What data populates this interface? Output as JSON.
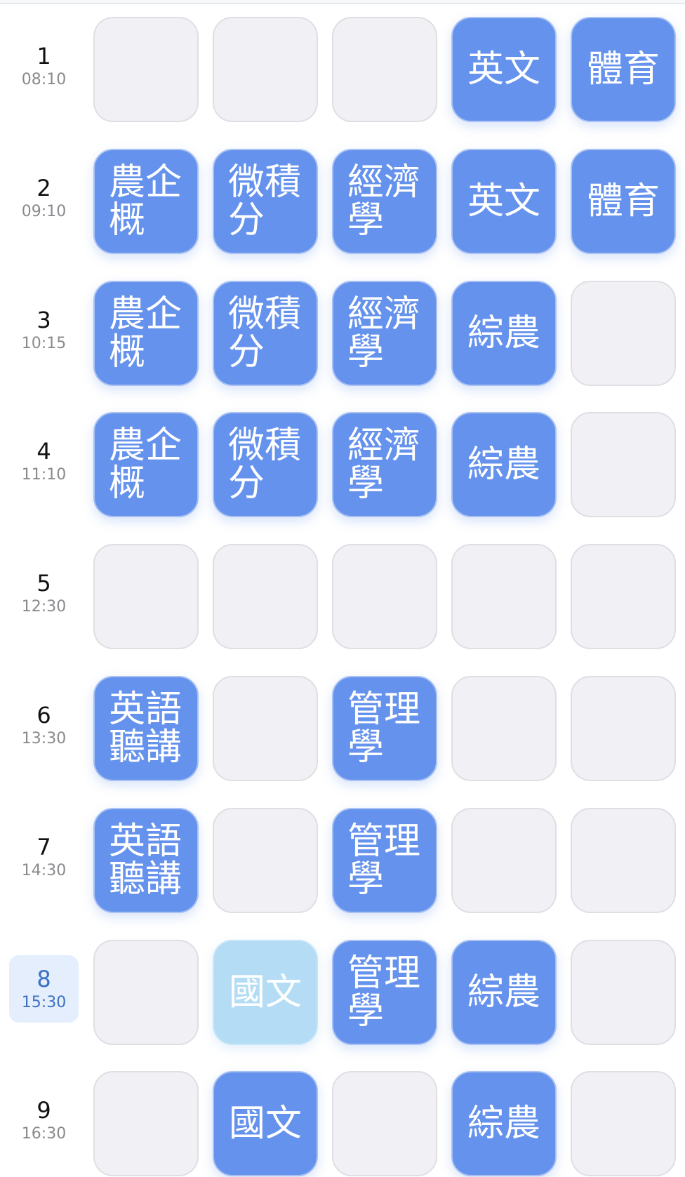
{
  "colors": {
    "course": "#6592ec",
    "course_current": "#b4ddf5",
    "empty": "#f1f1f5",
    "current_period_bg": "#e4eefc",
    "current_period_text": "#3b70c4"
  },
  "periods": [
    {
      "num": "1",
      "time": "08:10",
      "current": false,
      "cells": [
        "",
        "",
        "",
        "英文",
        "體育"
      ]
    },
    {
      "num": "2",
      "time": "09:10",
      "current": false,
      "cells": [
        "農企概",
        "微積分",
        "經濟學",
        "英文",
        "體育"
      ]
    },
    {
      "num": "3",
      "time": "10:15",
      "current": false,
      "cells": [
        "農企概",
        "微積分",
        "經濟學",
        "綜農",
        ""
      ]
    },
    {
      "num": "4",
      "time": "11:10",
      "current": false,
      "cells": [
        "農企概",
        "微積分",
        "經濟學",
        "綜農",
        ""
      ]
    },
    {
      "num": "5",
      "time": "12:30",
      "current": false,
      "cells": [
        "",
        "",
        "",
        "",
        ""
      ]
    },
    {
      "num": "6",
      "time": "13:30",
      "current": false,
      "cells": [
        "英語聽講",
        "",
        "管理學",
        "",
        ""
      ]
    },
    {
      "num": "7",
      "time": "14:30",
      "current": false,
      "cells": [
        "英語聽講",
        "",
        "管理學",
        "",
        ""
      ]
    },
    {
      "num": "8",
      "time": "15:30",
      "current": true,
      "cells": [
        "",
        "國文",
        "管理學",
        "綜農",
        ""
      ],
      "current_cell": 1
    },
    {
      "num": "9",
      "time": "16:30",
      "current": false,
      "cells": [
        "",
        "國文",
        "",
        "綜農",
        ""
      ]
    }
  ]
}
